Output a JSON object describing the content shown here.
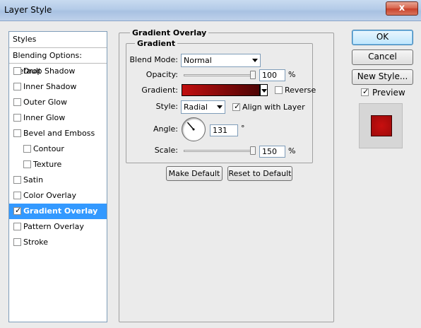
{
  "window": {
    "title": "Layer Style",
    "close_glyph": "x"
  },
  "list": {
    "header": "Styles",
    "blending": "Blending Options: Default",
    "items": [
      {
        "label": "Drop Shadow",
        "checked": false,
        "sub": false,
        "selected": false
      },
      {
        "label": "Inner Shadow",
        "checked": false,
        "sub": false,
        "selected": false
      },
      {
        "label": "Outer Glow",
        "checked": false,
        "sub": false,
        "selected": false
      },
      {
        "label": "Inner Glow",
        "checked": false,
        "sub": false,
        "selected": false
      },
      {
        "label": "Bevel and Emboss",
        "checked": false,
        "sub": false,
        "selected": false
      },
      {
        "label": "Contour",
        "checked": false,
        "sub": true,
        "selected": false
      },
      {
        "label": "Texture",
        "checked": false,
        "sub": true,
        "selected": false
      },
      {
        "label": "Satin",
        "checked": false,
        "sub": false,
        "selected": false
      },
      {
        "label": "Color Overlay",
        "checked": false,
        "sub": false,
        "selected": false
      },
      {
        "label": "Gradient Overlay",
        "checked": true,
        "sub": false,
        "selected": true
      },
      {
        "label": "Pattern Overlay",
        "checked": false,
        "sub": false,
        "selected": false
      },
      {
        "label": "Stroke",
        "checked": false,
        "sub": false,
        "selected": false
      }
    ]
  },
  "panel": {
    "group_title": "Gradient Overlay",
    "sub_title": "Gradient",
    "blend_mode_label": "Blend Mode:",
    "blend_mode_value": "Normal",
    "opacity_label": "Opacity:",
    "opacity_value": "100",
    "opacity_fraction": 1.0,
    "percent": "%",
    "gradient_label": "Gradient:",
    "gradient_colors": [
      "#c10e0e",
      "#4d0404"
    ],
    "reverse_label": "Reverse",
    "reverse_checked": false,
    "style_label": "Style:",
    "style_value": "Radial",
    "align_label": "Align with Layer",
    "align_checked": true,
    "angle_label": "Angle:",
    "angle_value": "131",
    "angle_degrees": 131,
    "degree": "°",
    "scale_label": "Scale:",
    "scale_value": "150",
    "scale_fraction": 1.0,
    "make_default": "Make Default",
    "reset_default": "Reset to Default"
  },
  "actions": {
    "ok": "OK",
    "cancel": "Cancel",
    "new_style": "New Style...",
    "preview_label": "Preview",
    "preview_checked": true
  },
  "colors": {
    "selection": "#3399ff",
    "preview_red": "#c80f0f"
  }
}
